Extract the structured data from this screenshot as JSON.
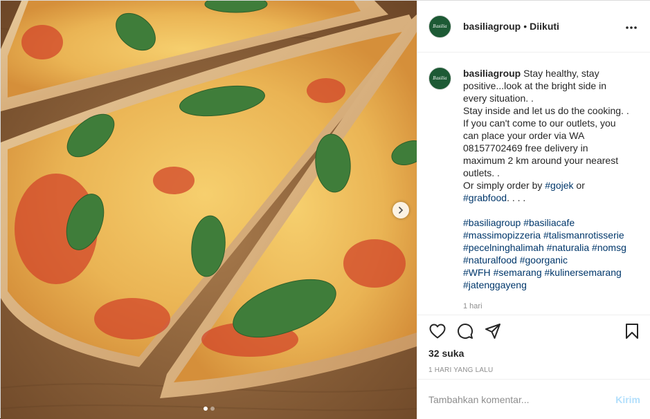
{
  "account": {
    "username": "basiliagroup",
    "separator": "•",
    "follow_status": "Diikuti",
    "avatar_text": "Basilia",
    "avatar_color": "#1d5a35"
  },
  "caption": {
    "username": "basiliagroup",
    "lines": [
      "Stay healthy, stay",
      "positive...look at the bright side in",
      "every situation. .",
      "Stay inside and let us do the cooking. .",
      "If you can't come to our outlets, you",
      "can place your order via WA",
      "08157702469 free delivery in",
      "maximum 2 km around your nearest",
      "outlets. ."
    ],
    "order_prefix": "Or simply order by ",
    "order_tag1": "#gojek",
    "order_mid": " or",
    "order_tag2": "#grabfood",
    "order_suffix": ". . . .",
    "hashtag_lines": [
      [
        "#basiliagroup",
        "#basiliacafe"
      ],
      [
        "#massimopizzeria",
        "#talismanrotisserie"
      ],
      [
        "#pecelninghalimah",
        "#naturalia",
        "#nomsg"
      ],
      [
        "#naturalfood",
        "#goorganic"
      ],
      [
        "#WFH",
        "#semarang",
        "#kulinersemarang"
      ],
      [
        "#jatenggayeng"
      ]
    ],
    "time_ago": "1 hari"
  },
  "actions": {
    "like_icon": "heart-icon",
    "comment_icon": "comment-icon",
    "share_icon": "share-icon",
    "save_icon": "bookmark-icon",
    "likes_text": "32 suka",
    "date_text": "1 HARI YANG LALU"
  },
  "comment_box": {
    "placeholder": "Tambahkan komentar...",
    "post_label": "Kirim",
    "post_color": "#b2dffc"
  },
  "media": {
    "description_icon": "pizza-photo",
    "carousel_total": 2,
    "carousel_active": 1
  },
  "colors": {
    "link": "#00376b",
    "muted": "#8e8e8e",
    "text": "#262626"
  }
}
